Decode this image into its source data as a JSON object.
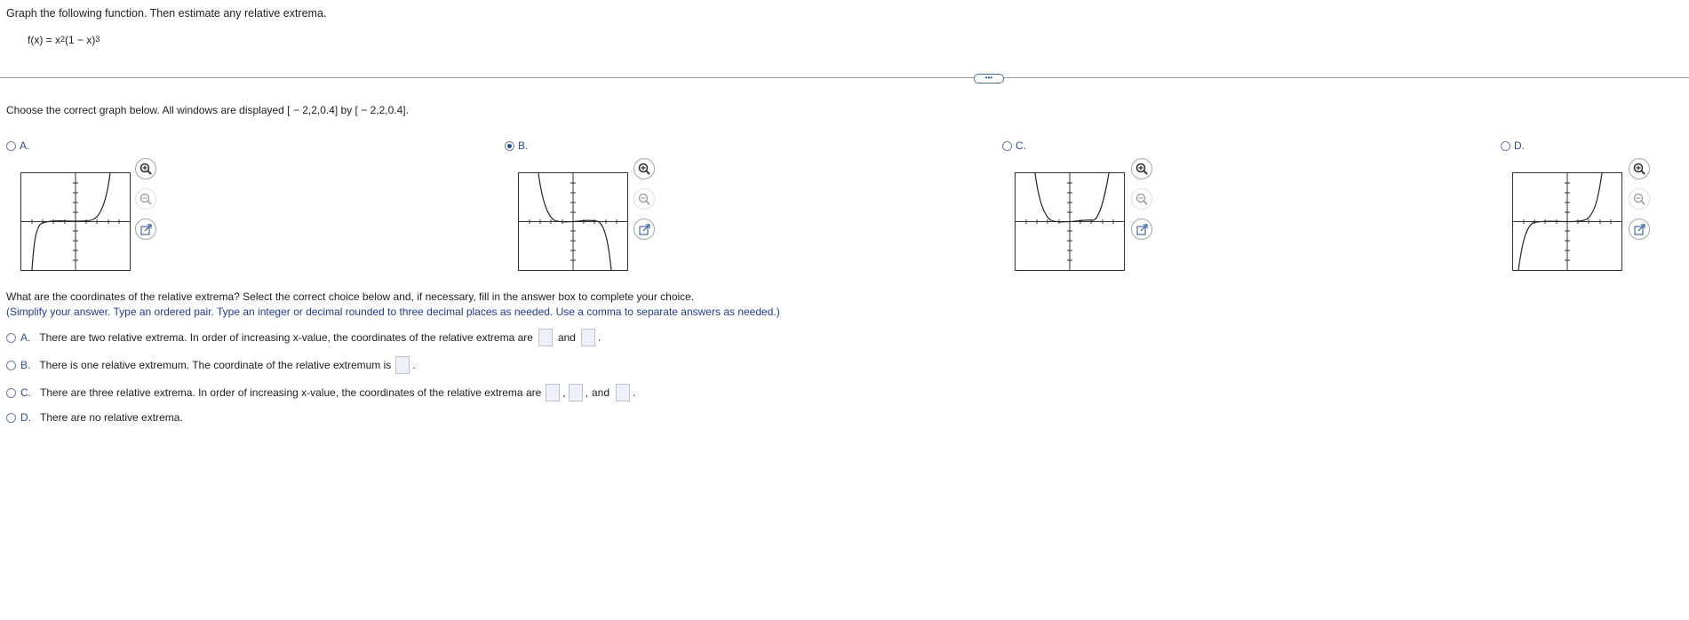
{
  "prompt": "Graph the following function. Then estimate any relative extrema.",
  "function": {
    "lhs": "f(x) = x",
    "exp1": "2",
    "mid": "(1 − x)",
    "exp2": "3"
  },
  "more_button": "•••",
  "part1": {
    "instruction": "Choose the correct graph below. All windows are displayed [ − 2,2,0.4] by [ − 2,2,0.4].",
    "options": [
      {
        "letter": "A.",
        "selected": false
      },
      {
        "letter": "B.",
        "selected": true
      },
      {
        "letter": "C.",
        "selected": false
      },
      {
        "letter": "D.",
        "selected": false
      }
    ],
    "tools": [
      "zoom-in-icon",
      "zoom-out-icon",
      "open-new-window-icon"
    ]
  },
  "part2": {
    "question": "What are the coordinates of the relative extrema? Select the correct choice below and, if necessary, fill in the answer box to complete your choice.",
    "note": "(Simplify your answer. Type an ordered pair. Type an integer or decimal rounded to three decimal places as needed. Use a comma to separate answers as needed.)",
    "choices": {
      "a": {
        "letter": "A.",
        "text": "There are two relative extrema. In order of increasing x-value, the coordinates of the relative extrema are",
        "and": "and",
        "end": "."
      },
      "b": {
        "letter": "B.",
        "text": "There is one relative extremum. The coordinate of the relative extremum is",
        "end": "."
      },
      "c": {
        "letter": "C.",
        "text": "There are three relative extrema. In order of increasing x-value, the coordinates of the relative extrema are",
        "comma1": ",",
        "comma2": ",",
        "and": "and",
        "end": "."
      },
      "d": {
        "letter": "D.",
        "text": "There are no relative extrema."
      }
    }
  },
  "colors": {
    "accent": "#2e4d99",
    "note": "#1f3a9a"
  }
}
